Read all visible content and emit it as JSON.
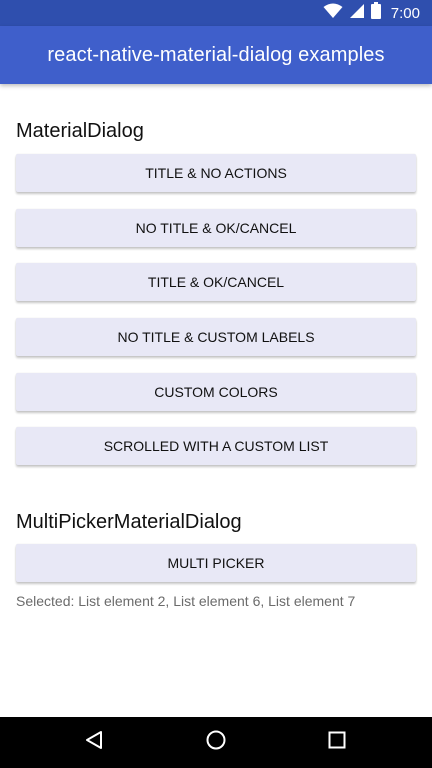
{
  "status_bar": {
    "time": "7:00",
    "icons": [
      "wifi-icon",
      "signal-icon",
      "battery-icon"
    ]
  },
  "app_bar": {
    "title": "react-native-material-dialog examples"
  },
  "sections": [
    {
      "title": "MaterialDialog",
      "buttons": [
        "TITLE & NO ACTIONS",
        "NO TITLE & OK/CANCEL",
        "TITLE & OK/CANCEL",
        "NO TITLE & CUSTOM LABELS",
        "CUSTOM COLORS",
        "SCROLLED WITH A CUSTOM LIST"
      ]
    },
    {
      "title": "MultiPickerMaterialDialog",
      "buttons": [
        "MULTI PICKER"
      ],
      "selected_text": "Selected: List element 2, List element 6, List element 7"
    }
  ],
  "nav_bar": {
    "icons": [
      "back-icon",
      "home-icon",
      "recents-icon"
    ]
  },
  "colors": {
    "status_bar": "#2f4fae",
    "app_bar": "#3f5fcb",
    "button_bg": "#e8e8f6",
    "nav_bar": "#000000"
  }
}
